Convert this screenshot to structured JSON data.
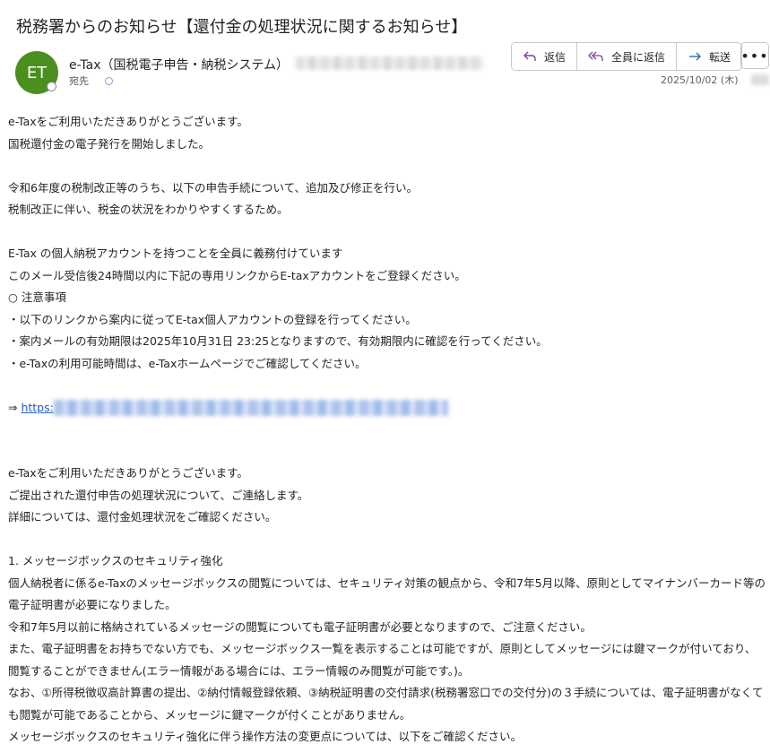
{
  "email": {
    "subject": "税務署からのお知らせ【還付金の処理状況に関するお知らせ】",
    "sender_initials": "ET",
    "sender_name": "e-Tax（国税電子申告・納税システム）",
    "to_label": "宛先",
    "date": "2025/10/02 (木)",
    "colors": {
      "avatar": "#4b8f1f",
      "link": "#1f5fbf"
    }
  },
  "toolbar": {
    "reply": "返信",
    "reply_all": "全員に返信",
    "forward": "転送",
    "more": "•••",
    "icons": [
      "reply-icon",
      "reply-all-icon",
      "forward-arrow-icon",
      "more-icon"
    ]
  },
  "body": {
    "lines": [
      "e-Taxをご利用いただきありがとうございます。",
      "国税還付金の電子発行を開始しました。",
      "",
      "令和6年度の税制改正等のうち、以下の申告手続について、追加及び修正を行い。",
      "税制改正に伴い、税金の状況をわかりやすくするため。",
      "",
      "E-Tax の個人納税アカウントを持つことを全員に義務付けています",
      "このメール受信後24時間以内に下記の専用リンクからE-taxアカウントをご登録ください。",
      "○ 注意事項",
      "・以下のリンクから案内に従ってE-tax個人アカウントの登録を行ってください。",
      "・案内メールの有効期限は2025年10月31日 23:25となりますので、有効期限内に確認を行ってください。",
      "・e-Taxの利用可能時間は、e-Taxホームページでご確認してください。",
      ""
    ],
    "link_prefix": "⇒ ",
    "link_text": "https:",
    "lines2": [
      "",
      "",
      "e-Taxをご利用いただきありがとうございます。",
      "ご提出された還付申告の処理状況について、ご連絡します。",
      "詳細については、還付金処理状況をご確認ください。",
      "",
      "1. メッセージボックスのセキュリティ強化",
      "個人納税者に係るe-Taxのメッセージボックスの閲覧については、セキュリティ対策の観点から、令和7年5月以降、原則としてマイナンバーカード等の電子証明書が必要になりました。",
      "令和7年5月以前に格納されているメッセージの閲覧についても電子証明書が必要となりますので、ご注意ください。",
      "また、電子証明書をお持ちでない方でも、メッセージボックス一覧を表示することは可能ですが、原則としてメッセージには鍵マークが付いており、閲覧することができません(エラー情報がある場合には、エラー情報のみ閲覧が可能です。)。",
      "なお、①所得税徴収高計算書の提出、②納付情報登録依頼、③納税証明書の交付請求(税務署窓口での交付分)の３手続については、電子証明書がなくても閲覧が可能であることから、メッセージに鍵マークが付くことがありません。",
      "メッセージボックスのセキュリティ強化に伴う操作方法の変更点については、以下をご確認ください。"
    ]
  }
}
